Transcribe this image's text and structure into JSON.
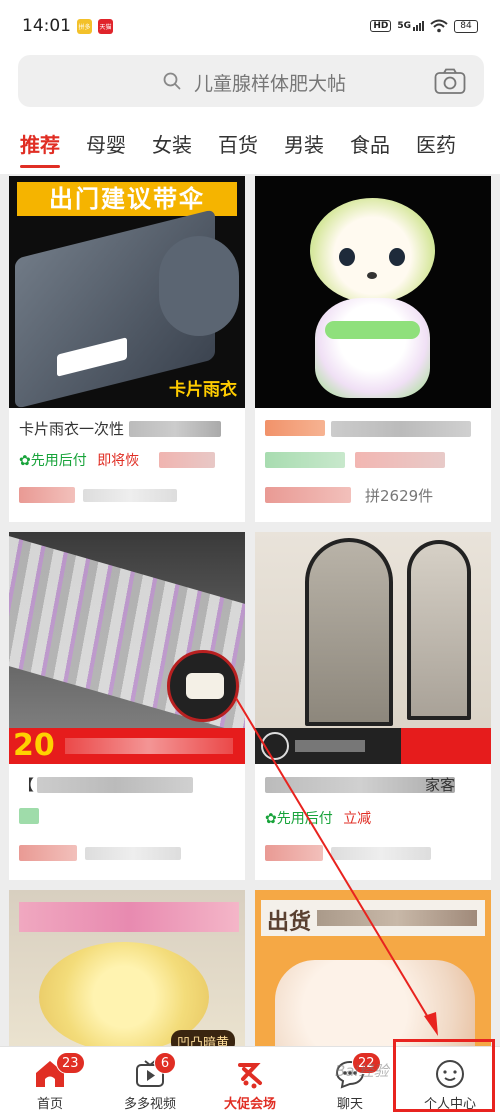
{
  "status_bar": {
    "time": "14:01",
    "app_icons": [
      {
        "text": "拼多",
        "color": "#f3c12a"
      },
      {
        "text": "天猫",
        "color": "#e0242b"
      }
    ],
    "hd": "HD",
    "network": "5G",
    "battery": "84"
  },
  "search": {
    "placeholder": "儿童腺样体肥大帖",
    "icon": "search-icon",
    "camera_icon": "camera-icon"
  },
  "tabs": [
    {
      "label": "推荐",
      "active": true
    },
    {
      "label": "母婴",
      "active": false
    },
    {
      "label": "女装",
      "active": false
    },
    {
      "label": "百货",
      "active": false
    },
    {
      "label": "男装",
      "active": false
    },
    {
      "label": "食品",
      "active": false
    },
    {
      "label": "医药",
      "active": false
    }
  ],
  "products": [
    {
      "image_banner": "出门建议带伞",
      "image_label": "卡片雨衣",
      "title": "卡片雨衣一次性",
      "tag_green": "先用后付",
      "tag_red": "即将恢",
      "sold": ""
    },
    {
      "image_banner": "",
      "image_label": "",
      "title": "",
      "tag_green": "",
      "tag_red": "",
      "sold": "拼2629件"
    },
    {
      "image_banner": "20",
      "image_label": "",
      "title": "【",
      "tag_green": "",
      "tag_red": "",
      "sold": ""
    },
    {
      "image_banner": "",
      "image_label": "",
      "title": "",
      "tag_green": "先用后付",
      "tag_red": "立减",
      "sold": "",
      "title_suffix": "家客"
    },
    {
      "image_banner": "",
      "image_label": "凹凸暗黄",
      "title": "",
      "tag_green": "",
      "tag_red": "",
      "sold": ""
    },
    {
      "image_banner": "出货",
      "image_label": "",
      "title": "",
      "tag_green": "",
      "tag_red": "",
      "sold": ""
    }
  ],
  "bottom_nav": [
    {
      "label": "首页",
      "icon": "home-icon",
      "badge": "23"
    },
    {
      "label": "多多视频",
      "icon": "video-icon",
      "badge": "6"
    },
    {
      "label": "大促会场",
      "icon": "promo-icon",
      "badge": ""
    },
    {
      "label": "聊天",
      "icon": "chat-icon",
      "badge": "22"
    },
    {
      "label": "个人中心",
      "icon": "profile-icon",
      "badge": ""
    }
  ],
  "watermark": "Bai经验",
  "colors": {
    "accent": "#e02e24",
    "green": "#17a33a"
  }
}
